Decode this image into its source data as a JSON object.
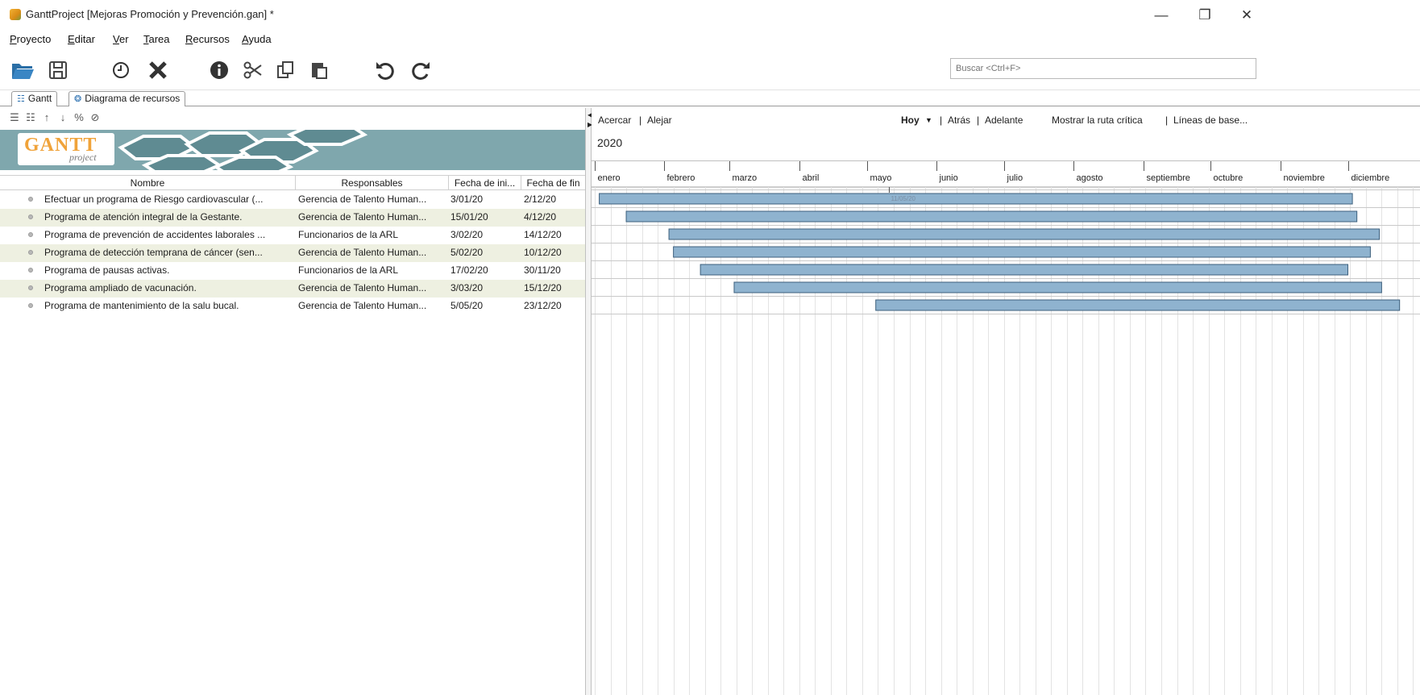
{
  "window": {
    "title": "GanttProject [Mejoras Promoción y Prevención.gan] *",
    "controls": {
      "minimize": "—",
      "maximize": "❐",
      "close": "✕"
    }
  },
  "menu": [
    "Proyecto",
    "Editar",
    "Ver",
    "Tarea",
    "Recursos",
    "Ayuda"
  ],
  "toolbar": {
    "icons": [
      "open-folder-icon",
      "save-icon",
      "clock-icon",
      "delete-icon",
      "info-icon",
      "cut-icon",
      "copy-icon",
      "paste-icon",
      "undo-icon",
      "redo-icon"
    ],
    "search_placeholder": "Buscar <Ctrl+F>"
  },
  "tabs": [
    {
      "label": "Gantt",
      "icon": "gantt-tab-icon"
    },
    {
      "label": "Diagrama de recursos",
      "icon": "resources-tab-icon"
    }
  ],
  "logo": {
    "word": "GANTT",
    "sub": "project"
  },
  "table": {
    "columns": [
      "Nombre",
      "Responsables",
      "Fecha de ini...",
      "Fecha de fin"
    ],
    "rows": [
      {
        "name": "Efectuar un programa de Riesgo cardiovascular (...",
        "resp": "Gerencia de Talento Human...",
        "start": "3/01/20",
        "end": "2/12/20"
      },
      {
        "name": "Programa de atención integral de la Gestante.",
        "resp": "Gerencia de Talento Human...",
        "start": "15/01/20",
        "end": "4/12/20"
      },
      {
        "name": "Programa de prevención de accidentes laborales ...",
        "resp": "Funcionarios de la ARL",
        "start": "3/02/20",
        "end": "14/12/20"
      },
      {
        "name": "Programa de detección temprana de cáncer (sen...",
        "resp": "Gerencia de Talento Human...",
        "start": "5/02/20",
        "end": "10/12/20"
      },
      {
        "name": "Programa de pausas activas.",
        "resp": "Funcionarios de la ARL",
        "start": "17/02/20",
        "end": "30/11/20"
      },
      {
        "name": "Programa ampliado de vacunación.",
        "resp": "Gerencia de Talento Human...",
        "start": "3/03/20",
        "end": "15/12/20"
      },
      {
        "name": "Programa de mantenimiento de la salu bucal.",
        "resp": "Gerencia de Talento Human...",
        "start": "5/05/20",
        "end": "23/12/20"
      }
    ]
  },
  "chart_toolbar": {
    "zoom_in": "Acercar",
    "zoom_out": "Alejar",
    "today": "Hoy",
    "back": "Atrás",
    "forward": "Adelante",
    "critical_path": "Mostrar la ruta crítica",
    "baselines": "Líneas de base...",
    "sep": "|"
  },
  "timeline": {
    "year": "2020",
    "months": [
      "enero",
      "febrero",
      "marzo",
      "abril",
      "mayo",
      "junio",
      "julio",
      "agosto",
      "septiembre",
      "octubre",
      "noviembre",
      "diciembre"
    ],
    "today_marker": "11/05/20",
    "bar_color": "#8fb3cf",
    "bar_border": "#3c5f7c"
  }
}
